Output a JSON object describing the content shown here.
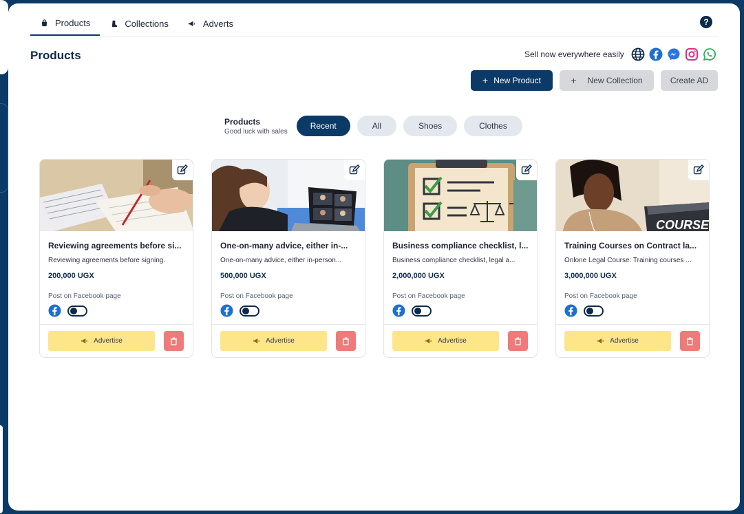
{
  "tabs": [
    {
      "label": "Products",
      "icon": "bag-icon",
      "active": true
    },
    {
      "label": "Collections",
      "icon": "boot-icon",
      "active": false
    },
    {
      "label": "Adverts",
      "icon": "megaphone-icon",
      "active": false
    }
  ],
  "page": {
    "title": "Products"
  },
  "sell": {
    "text": "Sell now everywhere easily",
    "icons": [
      "globe-icon",
      "facebook-icon",
      "messenger-icon",
      "instagram-icon",
      "whatsapp-icon"
    ]
  },
  "actions": {
    "new_product": "New Product",
    "new_collection": "New Collection",
    "create_ad": "Create AD"
  },
  "filter": {
    "title": "Products",
    "subtitle": "Good luck with sales",
    "chips": [
      "Recent",
      "All",
      "Shoes",
      "Clothes"
    ],
    "active": "Recent"
  },
  "card_labels": {
    "post": "Post on Facebook page",
    "advertise": "Advertise"
  },
  "products": [
    {
      "title": "Reviewing agreements before si...",
      "desc": "Reviewing agreements before signing.",
      "price": "200,000 UGX"
    },
    {
      "title": "One-on-many advice, either in-...",
      "desc": "One-on-many advice, either in-person...",
      "price": "500,000 UGX"
    },
    {
      "title": "Business compliance checklist, l...",
      "desc": "Business compliance checklist, legal a...",
      "price": "2,000,000 UGX"
    },
    {
      "title": "Training Courses on Contract la...",
      "desc": "Onlone Legal Course: Training courses ...",
      "price": "3,000,000 UGX"
    }
  ],
  "image_text": {
    "course": "COURSE"
  },
  "colors": {
    "brand": "#0c3a66",
    "advertise": "#fde68a",
    "delete": "#f07a7a",
    "chip": "#e3e7ee"
  }
}
